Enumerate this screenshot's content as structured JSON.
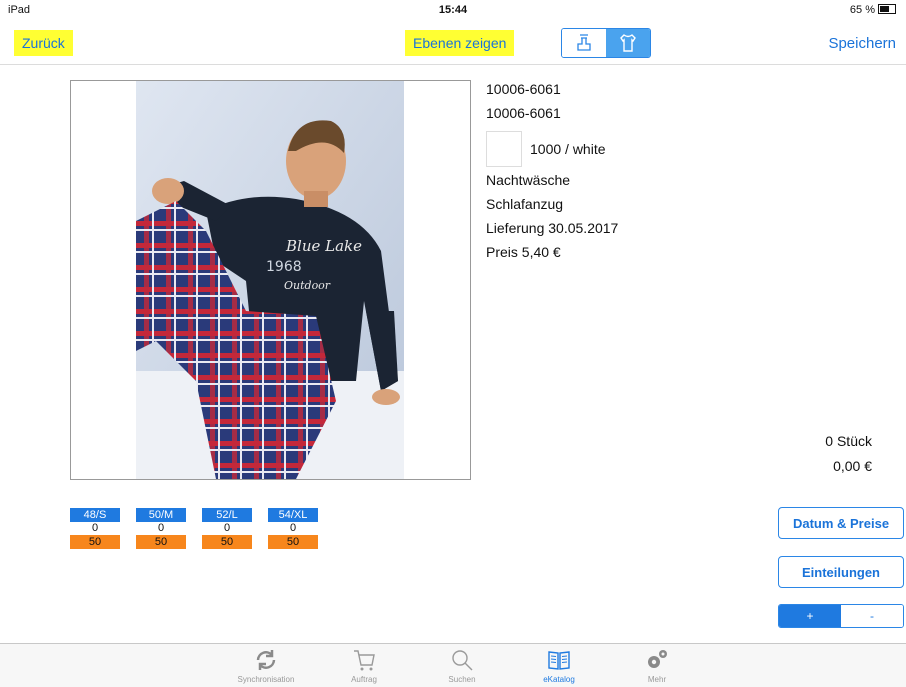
{
  "status": {
    "device": "iPad",
    "time": "15:44",
    "battery": "65 %"
  },
  "nav": {
    "back": "Zurück",
    "layers": "Ebenen zeigen",
    "save": "Speichern"
  },
  "product": {
    "number": "10006-6061",
    "number2": "10006-6061",
    "color": "1000 / white",
    "category": "Nachtwäsche",
    "type": "Schlafanzug",
    "delivery": "Lieferung 30.05.2017",
    "price": "Preis 5,40 €",
    "print_lines": [
      "Blue Lake",
      "1968",
      "Outdoor"
    ]
  },
  "sizes": [
    {
      "label": "48/S",
      "qty": "0",
      "stock": "50"
    },
    {
      "label": "50/M",
      "qty": "0",
      "stock": "50"
    },
    {
      "label": "52/L",
      "qty": "0",
      "stock": "50"
    },
    {
      "label": "54/XL",
      "qty": "0",
      "stock": "50"
    }
  ],
  "totals": {
    "count": "0 Stück",
    "amount": "0,00 €"
  },
  "buttons": {
    "dates": "Datum & Preise",
    "divisions": "Einteilungen",
    "plus": "+",
    "minus": "-"
  },
  "tabs": [
    {
      "label": "Synchronisation",
      "icon": "sync-icon"
    },
    {
      "label": "Auftrag",
      "icon": "cart-icon"
    },
    {
      "label": "Suchen",
      "icon": "search-icon"
    },
    {
      "label": "eKatalog",
      "icon": "book-icon"
    },
    {
      "label": "Mehr",
      "icon": "gears-icon"
    }
  ],
  "colors": {
    "accent": "#1f7ae0",
    "highlight": "#ffff33",
    "stock": "#f7861c"
  }
}
